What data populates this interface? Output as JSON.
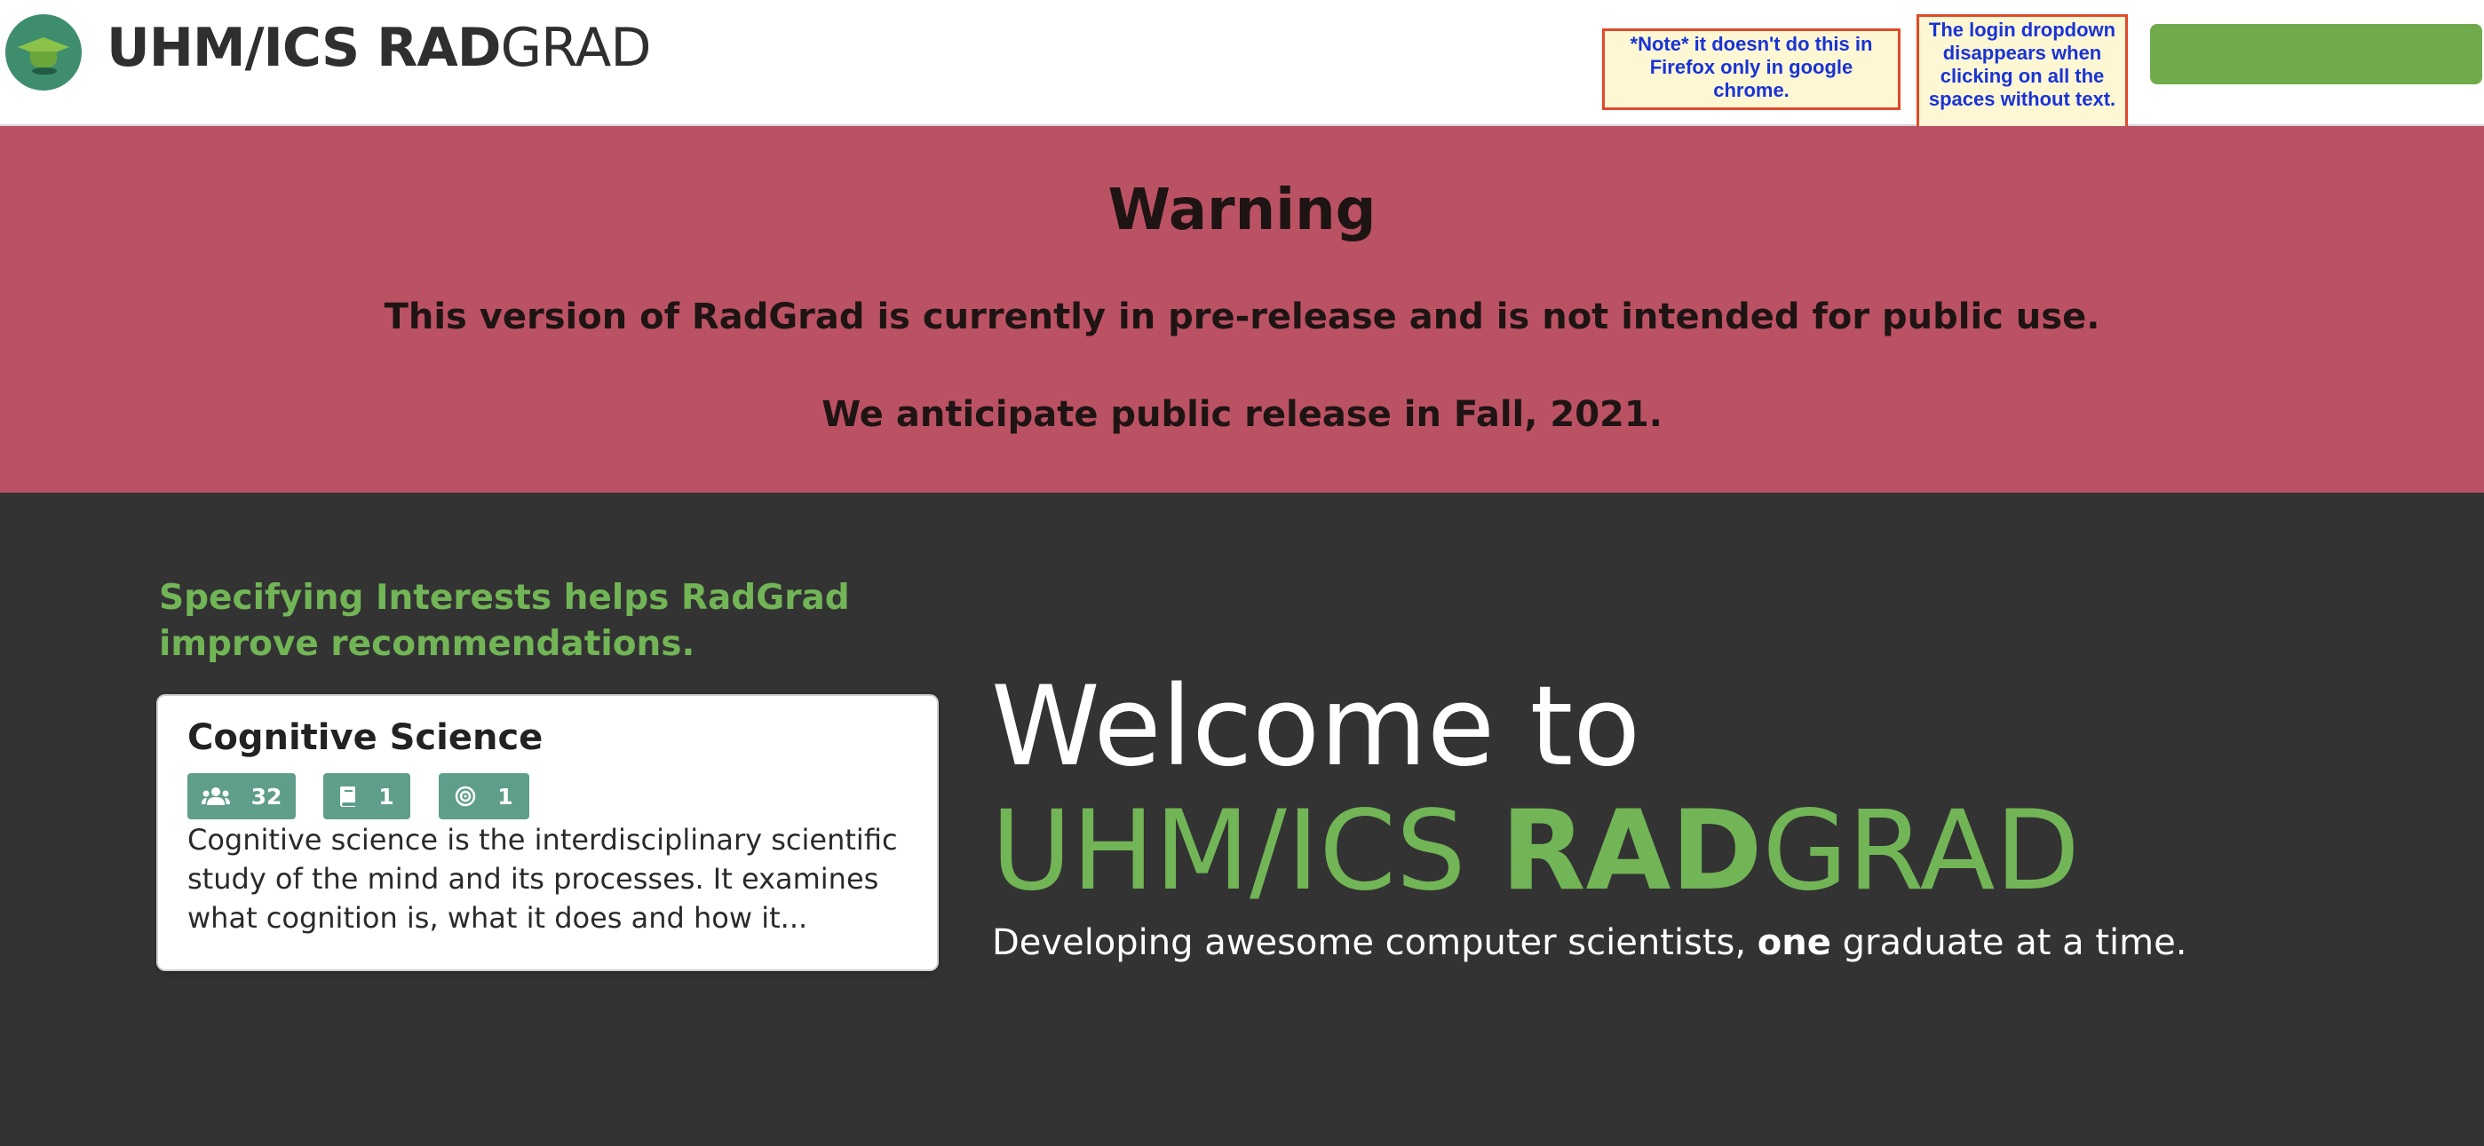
{
  "header": {
    "brand_bold": "UHM/ICS RAD",
    "brand_light": "GRAD",
    "notes": [
      "*Note* it doesn't do this in Firefox only in google chrome.",
      "The login dropdown disappears when clicking on all the spaces without text."
    ],
    "login_label": ""
  },
  "warning": {
    "title": "Warning",
    "line1": "This version of RadGrad is currently in pre-release and is not intended for public use.",
    "line2": "We anticipate public release in Fall, 2021."
  },
  "interest": {
    "tip": "Specifying Interests helps RadGrad improve recommendations.",
    "card": {
      "title": "Cognitive Science",
      "badges": [
        {
          "icon": "users-icon",
          "value": "32"
        },
        {
          "icon": "book-icon",
          "value": "1"
        },
        {
          "icon": "target-icon",
          "value": "1"
        }
      ],
      "description": "Cognitive science is the interdisciplinary scientific study of the mind and its processes. It examines what cognition is, what it does and how it..."
    }
  },
  "welcome": {
    "line1": "Welcome to",
    "brand_part1": "UHM/ICS ",
    "brand_part2": "RAD",
    "brand_part3": "GRAD",
    "tagline_part1": "Developing awesome computer scientists, ",
    "tagline_bold": "one",
    "tagline_part2": " graduate at a time."
  },
  "colors": {
    "accent_green": "#72b556",
    "warning_bg": "#bb5263",
    "dark_bg": "#333333",
    "badge_teal": "#5f9e8a",
    "login_green": "#6fab4a"
  }
}
